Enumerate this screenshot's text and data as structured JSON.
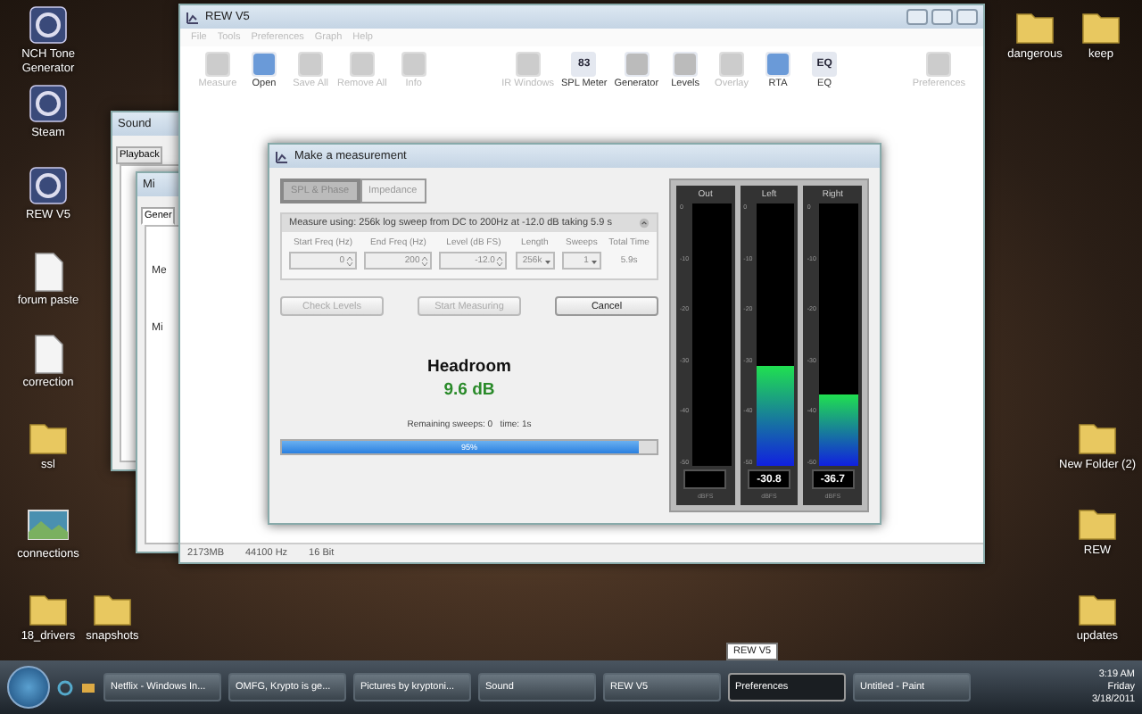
{
  "desktop": {
    "left_icons": [
      {
        "label": "NCH Tone Generator",
        "kind": "app"
      },
      {
        "label": "Steam",
        "kind": "app"
      },
      {
        "label": "REW V5",
        "kind": "app"
      },
      {
        "label": "forum paste",
        "kind": "document"
      },
      {
        "label": "correction",
        "kind": "document"
      },
      {
        "label": "ssl",
        "kind": "folder"
      },
      {
        "label": "connections",
        "kind": "image"
      }
    ],
    "bottom_icons": [
      {
        "label": "18_drivers",
        "kind": "folder"
      },
      {
        "label": "snapshots",
        "kind": "folder"
      }
    ],
    "top_right_icons": [
      {
        "label": "dangerous",
        "kind": "folder"
      },
      {
        "label": "keep",
        "kind": "folder"
      }
    ],
    "right_icons": [
      {
        "label": "New Folder (2)",
        "kind": "folder"
      },
      {
        "label": "REW",
        "kind": "folder"
      },
      {
        "label": "updates",
        "kind": "folder"
      }
    ]
  },
  "sound_window": {
    "title": "Sound",
    "tabs": [
      {
        "label": "Playback",
        "selected": false
      }
    ]
  },
  "mic_window": {
    "title": "Mi",
    "tabs": [
      {
        "label": "Gener",
        "selected": true
      }
    ],
    "labels": [
      "Me",
      "Mi"
    ]
  },
  "rew_window": {
    "title": "REW V5",
    "menu": [
      "File",
      "Tools",
      "Preferences",
      "Graph",
      "Help"
    ],
    "toolbar_left": [
      {
        "label": "Measure",
        "disabled": true
      },
      {
        "label": "Open",
        "disabled": false
      },
      {
        "label": "Save All",
        "disabled": true
      },
      {
        "label": "Remove All",
        "disabled": true
      },
      {
        "label": "Info",
        "disabled": true
      }
    ],
    "toolbar_center": [
      {
        "label": "IR Windows",
        "disabled": true
      },
      {
        "label": "SPL Meter",
        "disabled": false,
        "display": "83"
      },
      {
        "label": "Generator",
        "disabled": false
      },
      {
        "label": "Levels",
        "disabled": false
      },
      {
        "label": "Overlay",
        "disabled": true
      },
      {
        "label": "RTA",
        "disabled": false
      },
      {
        "label": "EQ",
        "disabled": false,
        "display": "EQ"
      }
    ],
    "toolbar_right": [
      {
        "label": "Preferences",
        "disabled": true
      }
    ],
    "status_bar": [
      "2173MB",
      "44100 Hz",
      "16 Bit"
    ]
  },
  "dialog": {
    "title": "Make a measurement",
    "tabs": [
      {
        "label": "SPL & Phase",
        "selected": true
      },
      {
        "label": "Impedance",
        "selected": false
      }
    ],
    "summary": "Measure using: 256k log sweep from DC to 200Hz at -12.0 dB taking 5.9 s",
    "fields": [
      {
        "label": "Start Freq (Hz)",
        "value": "0",
        "kind": "spinner"
      },
      {
        "label": "End Freq (Hz)",
        "value": "200",
        "kind": "spinner"
      },
      {
        "label": "Level (dB FS)",
        "value": "-12.0",
        "kind": "spinner"
      },
      {
        "label": "Length",
        "value": "256k",
        "kind": "dropdown"
      },
      {
        "label": "Sweeps",
        "value": "1",
        "kind": "dropdown"
      },
      {
        "label": "Total Time",
        "value": "5.9s",
        "kind": "readout"
      }
    ],
    "buttons": [
      {
        "label": "Check Levels",
        "disabled": true
      },
      {
        "label": "Start Measuring",
        "disabled": true
      },
      {
        "label": "Cancel",
        "disabled": false
      }
    ],
    "headroom_label": "Headroom",
    "headroom_value": "9.6 dB",
    "remaining": "Remaining sweeps: 0   time: 1s",
    "progress": {
      "level": 0.95,
      "text": "95%"
    },
    "meters": [
      {
        "label": "Out",
        "scale": [
          "0",
          "-10",
          "-20",
          "-30",
          "-40",
          "-50"
        ],
        "unit": "dBFS"
      },
      {
        "label": "Left",
        "level": 0.38,
        "scale": [
          "0",
          "-10",
          "-20",
          "-30",
          "-40",
          "-50"
        ],
        "reading": "-30.8",
        "unit": "dBFS"
      },
      {
        "label": "Right",
        "level": 0.27,
        "scale": [
          "0",
          "-10",
          "-20",
          "-30",
          "-40",
          "-50"
        ],
        "reading": "-36.7",
        "unit": "dBFS"
      }
    ]
  },
  "taskbar": {
    "tasks": [
      {
        "label": "Netflix - Windows In...",
        "selected": false
      },
      {
        "label": "OMFG, Krypto is ge...",
        "selected": false
      },
      {
        "label": "Pictures by kryptoni...",
        "selected": false
      },
      {
        "label": "Sound",
        "selected": false
      },
      {
        "label": "REW V5",
        "selected": false
      },
      {
        "label": "Preferences",
        "selected": true
      },
      {
        "label": "Untitled - Paint",
        "selected": false
      }
    ],
    "tooltip": "REW V5",
    "time": "3:19 AM",
    "day": "Friday",
    "date": "3/18/2011"
  }
}
